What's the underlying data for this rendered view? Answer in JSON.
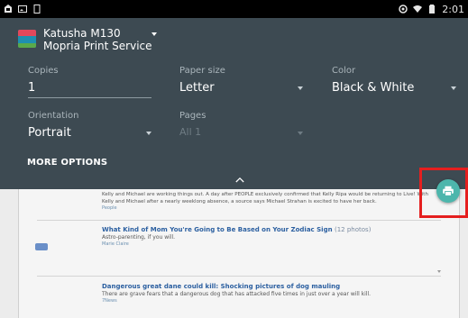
{
  "status_bar": {
    "time": "2:01",
    "icons": [
      "notification-icon",
      "image-icon",
      "tablet-icon",
      "vpn-key-icon",
      "wifi-icon",
      "battery-icon"
    ]
  },
  "printer": {
    "name": "Katusha M130",
    "service": "Mopria Print Service",
    "icon": "printer-logo-icon"
  },
  "fields": {
    "copies": {
      "label": "Copies",
      "value": "1"
    },
    "paper_size": {
      "label": "Paper size",
      "value": "Letter"
    },
    "color": {
      "label": "Color",
      "value": "Black & White"
    },
    "orientation": {
      "label": "Orientation",
      "value": "Portrait"
    },
    "pages": {
      "label": "Pages",
      "value": "All 1"
    }
  },
  "more_options": "MORE OPTIONS",
  "preview": {
    "story1": {
      "text": "Kelly and Michael are working things out. A day after PEOPLE exclusively confirmed that Kelly Ripa would be returning to Live! With Kelly and Michael after a nearly weeklong absence, a source says Michael Strahan is excited to have her back.",
      "source": "People"
    },
    "story2": {
      "title": "What Kind of Mom You're Going to Be Based on Your Zodiac Sign",
      "title_suffix": "(12 photos)",
      "sub": "Astro-parenting, if you will.",
      "source": "Marie Claire"
    },
    "story3": {
      "title": "Dangerous great dane could kill: Shocking pictures of dog mauling",
      "sub": "There are grave fears that a dangerous dog that has attacked five times in just over a year will kill.",
      "source": "7News"
    }
  },
  "colors": {
    "panel_bg": "#3d4a52",
    "fab": "#4db6ac",
    "highlight": "#e51f1f"
  }
}
